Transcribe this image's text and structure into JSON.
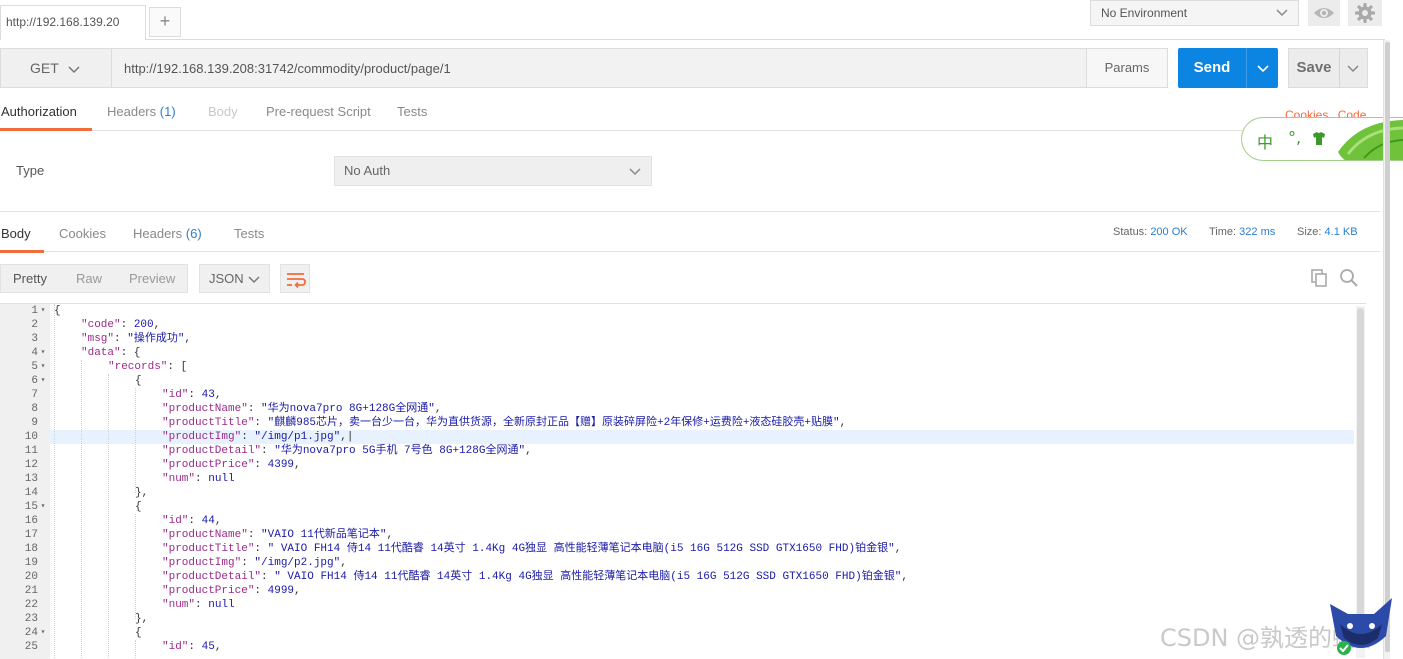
{
  "tabs": [
    {
      "label": "http://192.168.139.20"
    }
  ],
  "add_tab_label": "+",
  "environment": {
    "selected": "No Environment"
  },
  "request": {
    "method": "GET",
    "url": "http://192.168.139.208:31742/commodity/product/page/1",
    "params_label": "Params",
    "send_label": "Send",
    "save_label": "Save"
  },
  "request_tabs": {
    "authorization": "Authorization",
    "headers": "Headers",
    "headers_count": "(1)",
    "body": "Body",
    "prescript": "Pre-request Script",
    "tests": "Tests",
    "cookies_link": "Cookies",
    "code_link": "Code"
  },
  "auth": {
    "type_label": "Type",
    "type_value": "No Auth"
  },
  "ime": {
    "mode": "中",
    "punct": "°,"
  },
  "response_tabs": {
    "body": "Body",
    "cookies": "Cookies",
    "headers": "Headers",
    "headers_count": "(6)",
    "tests": "Tests"
  },
  "response_stats": {
    "status_label": "Status:",
    "status_value": "200 OK",
    "time_label": "Time:",
    "time_value": "322 ms",
    "size_label": "Size:",
    "size_value": "4.1 KB"
  },
  "viewer": {
    "modes": [
      "Pretty",
      "Raw",
      "Preview"
    ],
    "format": "JSON"
  },
  "colors": {
    "accent": "#f26b3a",
    "send": "#0b84e2",
    "link": "#2a7ed2"
  },
  "code_lines": [
    {
      "n": "1",
      "fold": true,
      "indent": 0,
      "parts": [
        [
          "p",
          "{"
        ]
      ]
    },
    {
      "n": "2",
      "fold": false,
      "indent": 1,
      "parts": [
        [
          "k",
          "\"code\""
        ],
        [
          "p",
          ": "
        ],
        [
          "n",
          "200"
        ],
        [
          "p",
          ","
        ]
      ]
    },
    {
      "n": "3",
      "fold": false,
      "indent": 1,
      "parts": [
        [
          "k",
          "\"msg\""
        ],
        [
          "p",
          ": "
        ],
        [
          "s",
          "\"操作成功\""
        ],
        [
          "p",
          ","
        ]
      ]
    },
    {
      "n": "4",
      "fold": true,
      "indent": 1,
      "parts": [
        [
          "k",
          "\"data\""
        ],
        [
          "p",
          ": {"
        ]
      ]
    },
    {
      "n": "5",
      "fold": true,
      "indent": 2,
      "parts": [
        [
          "k",
          "\"records\""
        ],
        [
          "p",
          ": ["
        ]
      ]
    },
    {
      "n": "6",
      "fold": true,
      "indent": 3,
      "parts": [
        [
          "p",
          "{"
        ]
      ]
    },
    {
      "n": "7",
      "fold": false,
      "indent": 4,
      "parts": [
        [
          "k",
          "\"id\""
        ],
        [
          "p",
          ": "
        ],
        [
          "n",
          "43"
        ],
        [
          "p",
          ","
        ]
      ]
    },
    {
      "n": "8",
      "fold": false,
      "indent": 4,
      "parts": [
        [
          "k",
          "\"productName\""
        ],
        [
          "p",
          ": "
        ],
        [
          "s",
          "\"华为nova7pro 8G+128G全网通\""
        ],
        [
          "p",
          ","
        ]
      ]
    },
    {
      "n": "9",
      "fold": false,
      "indent": 4,
      "parts": [
        [
          "k",
          "\"productTitle\""
        ],
        [
          "p",
          ": "
        ],
        [
          "s",
          "\"麒麟985芯片，卖一台少一台，华为直供货源，全新原封正品【赠】原装碎屏险+2年保修+运费险+液态硅胶壳+贴膜\""
        ],
        [
          "p",
          ","
        ]
      ]
    },
    {
      "n": "10",
      "fold": false,
      "indent": 4,
      "hl": true,
      "parts": [
        [
          "k",
          "\"productImg\""
        ],
        [
          "p",
          ": "
        ],
        [
          "s",
          "\"/img/p1.jpg\""
        ],
        [
          "p",
          ",|"
        ]
      ]
    },
    {
      "n": "11",
      "fold": false,
      "indent": 4,
      "parts": [
        [
          "k",
          "\"productDetail\""
        ],
        [
          "p",
          ": "
        ],
        [
          "s",
          "\"华为nova7pro 5G手机 7号色 8G+128G全网通\""
        ],
        [
          "p",
          ","
        ]
      ]
    },
    {
      "n": "12",
      "fold": false,
      "indent": 4,
      "parts": [
        [
          "k",
          "\"productPrice\""
        ],
        [
          "p",
          ": "
        ],
        [
          "n",
          "4399"
        ],
        [
          "p",
          ","
        ]
      ]
    },
    {
      "n": "13",
      "fold": false,
      "indent": 4,
      "parts": [
        [
          "k",
          "\"num\""
        ],
        [
          "p",
          ": "
        ],
        [
          "n",
          "null"
        ]
      ]
    },
    {
      "n": "14",
      "fold": false,
      "indent": 3,
      "parts": [
        [
          "p",
          "},"
        ]
      ]
    },
    {
      "n": "15",
      "fold": true,
      "indent": 3,
      "parts": [
        [
          "p",
          "{"
        ]
      ]
    },
    {
      "n": "16",
      "fold": false,
      "indent": 4,
      "parts": [
        [
          "k",
          "\"id\""
        ],
        [
          "p",
          ": "
        ],
        [
          "n",
          "44"
        ],
        [
          "p",
          ","
        ]
      ]
    },
    {
      "n": "17",
      "fold": false,
      "indent": 4,
      "parts": [
        [
          "k",
          "\"productName\""
        ],
        [
          "p",
          ": "
        ],
        [
          "s",
          "\"VAIO 11代新品笔记本\""
        ],
        [
          "p",
          ","
        ]
      ]
    },
    {
      "n": "18",
      "fold": false,
      "indent": 4,
      "parts": [
        [
          "k",
          "\"productTitle\""
        ],
        [
          "p",
          ": "
        ],
        [
          "s",
          "\" VAIO FH14 侍14 11代酷睿 14英寸 1.4Kg 4G独显 高性能轻薄笔记本电脑(i5 16G 512G SSD GTX1650 FHD)铂金银\""
        ],
        [
          "p",
          ","
        ]
      ]
    },
    {
      "n": "19",
      "fold": false,
      "indent": 4,
      "parts": [
        [
          "k",
          "\"productImg\""
        ],
        [
          "p",
          ": "
        ],
        [
          "s",
          "\"/img/p2.jpg\""
        ],
        [
          "p",
          ","
        ]
      ]
    },
    {
      "n": "20",
      "fold": false,
      "indent": 4,
      "parts": [
        [
          "k",
          "\"productDetail\""
        ],
        [
          "p",
          ": "
        ],
        [
          "s",
          "\" VAIO FH14 侍14 11代酷睿 14英寸 1.4Kg 4G独显 高性能轻薄笔记本电脑(i5 16G 512G SSD GTX1650 FHD)铂金银\""
        ],
        [
          "p",
          ","
        ]
      ]
    },
    {
      "n": "21",
      "fold": false,
      "indent": 4,
      "parts": [
        [
          "k",
          "\"productPrice\""
        ],
        [
          "p",
          ": "
        ],
        [
          "n",
          "4999"
        ],
        [
          "p",
          ","
        ]
      ]
    },
    {
      "n": "22",
      "fold": false,
      "indent": 4,
      "parts": [
        [
          "k",
          "\"num\""
        ],
        [
          "p",
          ": "
        ],
        [
          "n",
          "null"
        ]
      ]
    },
    {
      "n": "23",
      "fold": false,
      "indent": 3,
      "parts": [
        [
          "p",
          "},"
        ]
      ]
    },
    {
      "n": "24",
      "fold": true,
      "indent": 3,
      "parts": [
        [
          "p",
          "{"
        ]
      ]
    },
    {
      "n": "25",
      "fold": false,
      "indent": 4,
      "parts": [
        [
          "k",
          "\"id\""
        ],
        [
          "p",
          ": "
        ],
        [
          "n",
          "45"
        ],
        [
          "p",
          ","
        ]
      ]
    }
  ],
  "watermark": "CSDN @孰透的蜗牛"
}
